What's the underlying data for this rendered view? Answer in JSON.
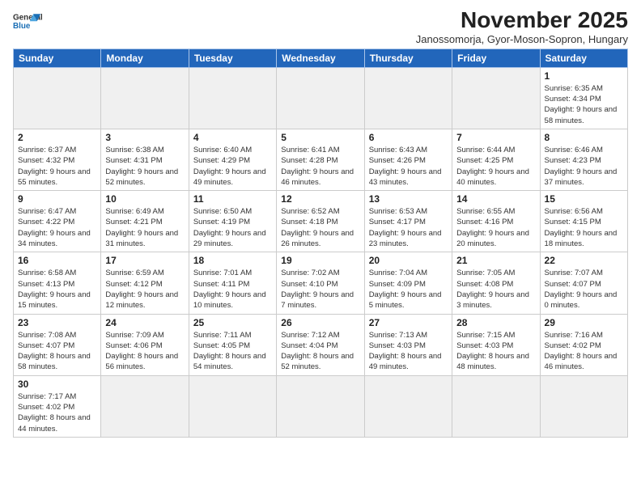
{
  "header": {
    "logo_general": "General",
    "logo_blue": "Blue",
    "month_title": "November 2025",
    "location": "Janossomorja, Gyor-Moson-Sopron, Hungary"
  },
  "days_of_week": [
    "Sunday",
    "Monday",
    "Tuesday",
    "Wednesday",
    "Thursday",
    "Friday",
    "Saturday"
  ],
  "weeks": [
    [
      {
        "day": "",
        "empty": true
      },
      {
        "day": "",
        "empty": true
      },
      {
        "day": "",
        "empty": true
      },
      {
        "day": "",
        "empty": true
      },
      {
        "day": "",
        "empty": true
      },
      {
        "day": "",
        "empty": true
      },
      {
        "day": "1",
        "sunrise": "Sunrise: 6:35 AM",
        "sunset": "Sunset: 4:34 PM",
        "daylight": "Daylight: 9 hours and 58 minutes."
      }
    ],
    [
      {
        "day": "2",
        "sunrise": "Sunrise: 6:37 AM",
        "sunset": "Sunset: 4:32 PM",
        "daylight": "Daylight: 9 hours and 55 minutes."
      },
      {
        "day": "3",
        "sunrise": "Sunrise: 6:38 AM",
        "sunset": "Sunset: 4:31 PM",
        "daylight": "Daylight: 9 hours and 52 minutes."
      },
      {
        "day": "4",
        "sunrise": "Sunrise: 6:40 AM",
        "sunset": "Sunset: 4:29 PM",
        "daylight": "Daylight: 9 hours and 49 minutes."
      },
      {
        "day": "5",
        "sunrise": "Sunrise: 6:41 AM",
        "sunset": "Sunset: 4:28 PM",
        "daylight": "Daylight: 9 hours and 46 minutes."
      },
      {
        "day": "6",
        "sunrise": "Sunrise: 6:43 AM",
        "sunset": "Sunset: 4:26 PM",
        "daylight": "Daylight: 9 hours and 43 minutes."
      },
      {
        "day": "7",
        "sunrise": "Sunrise: 6:44 AM",
        "sunset": "Sunset: 4:25 PM",
        "daylight": "Daylight: 9 hours and 40 minutes."
      },
      {
        "day": "8",
        "sunrise": "Sunrise: 6:46 AM",
        "sunset": "Sunset: 4:23 PM",
        "daylight": "Daylight: 9 hours and 37 minutes."
      }
    ],
    [
      {
        "day": "9",
        "sunrise": "Sunrise: 6:47 AM",
        "sunset": "Sunset: 4:22 PM",
        "daylight": "Daylight: 9 hours and 34 minutes."
      },
      {
        "day": "10",
        "sunrise": "Sunrise: 6:49 AM",
        "sunset": "Sunset: 4:21 PM",
        "daylight": "Daylight: 9 hours and 31 minutes."
      },
      {
        "day": "11",
        "sunrise": "Sunrise: 6:50 AM",
        "sunset": "Sunset: 4:19 PM",
        "daylight": "Daylight: 9 hours and 29 minutes."
      },
      {
        "day": "12",
        "sunrise": "Sunrise: 6:52 AM",
        "sunset": "Sunset: 4:18 PM",
        "daylight": "Daylight: 9 hours and 26 minutes."
      },
      {
        "day": "13",
        "sunrise": "Sunrise: 6:53 AM",
        "sunset": "Sunset: 4:17 PM",
        "daylight": "Daylight: 9 hours and 23 minutes."
      },
      {
        "day": "14",
        "sunrise": "Sunrise: 6:55 AM",
        "sunset": "Sunset: 4:16 PM",
        "daylight": "Daylight: 9 hours and 20 minutes."
      },
      {
        "day": "15",
        "sunrise": "Sunrise: 6:56 AM",
        "sunset": "Sunset: 4:15 PM",
        "daylight": "Daylight: 9 hours and 18 minutes."
      }
    ],
    [
      {
        "day": "16",
        "sunrise": "Sunrise: 6:58 AM",
        "sunset": "Sunset: 4:13 PM",
        "daylight": "Daylight: 9 hours and 15 minutes."
      },
      {
        "day": "17",
        "sunrise": "Sunrise: 6:59 AM",
        "sunset": "Sunset: 4:12 PM",
        "daylight": "Daylight: 9 hours and 12 minutes."
      },
      {
        "day": "18",
        "sunrise": "Sunrise: 7:01 AM",
        "sunset": "Sunset: 4:11 PM",
        "daylight": "Daylight: 9 hours and 10 minutes."
      },
      {
        "day": "19",
        "sunrise": "Sunrise: 7:02 AM",
        "sunset": "Sunset: 4:10 PM",
        "daylight": "Daylight: 9 hours and 7 minutes."
      },
      {
        "day": "20",
        "sunrise": "Sunrise: 7:04 AM",
        "sunset": "Sunset: 4:09 PM",
        "daylight": "Daylight: 9 hours and 5 minutes."
      },
      {
        "day": "21",
        "sunrise": "Sunrise: 7:05 AM",
        "sunset": "Sunset: 4:08 PM",
        "daylight": "Daylight: 9 hours and 3 minutes."
      },
      {
        "day": "22",
        "sunrise": "Sunrise: 7:07 AM",
        "sunset": "Sunset: 4:07 PM",
        "daylight": "Daylight: 9 hours and 0 minutes."
      }
    ],
    [
      {
        "day": "23",
        "sunrise": "Sunrise: 7:08 AM",
        "sunset": "Sunset: 4:07 PM",
        "daylight": "Daylight: 8 hours and 58 minutes."
      },
      {
        "day": "24",
        "sunrise": "Sunrise: 7:09 AM",
        "sunset": "Sunset: 4:06 PM",
        "daylight": "Daylight: 8 hours and 56 minutes."
      },
      {
        "day": "25",
        "sunrise": "Sunrise: 7:11 AM",
        "sunset": "Sunset: 4:05 PM",
        "daylight": "Daylight: 8 hours and 54 minutes."
      },
      {
        "day": "26",
        "sunrise": "Sunrise: 7:12 AM",
        "sunset": "Sunset: 4:04 PM",
        "daylight": "Daylight: 8 hours and 52 minutes."
      },
      {
        "day": "27",
        "sunrise": "Sunrise: 7:13 AM",
        "sunset": "Sunset: 4:03 PM",
        "daylight": "Daylight: 8 hours and 49 minutes."
      },
      {
        "day": "28",
        "sunrise": "Sunrise: 7:15 AM",
        "sunset": "Sunset: 4:03 PM",
        "daylight": "Daylight: 8 hours and 48 minutes."
      },
      {
        "day": "29",
        "sunrise": "Sunrise: 7:16 AM",
        "sunset": "Sunset: 4:02 PM",
        "daylight": "Daylight: 8 hours and 46 minutes."
      }
    ],
    [
      {
        "day": "30",
        "sunrise": "Sunrise: 7:17 AM",
        "sunset": "Sunset: 4:02 PM",
        "daylight": "Daylight: 8 hours and 44 minutes."
      },
      {
        "day": "",
        "empty": true
      },
      {
        "day": "",
        "empty": true
      },
      {
        "day": "",
        "empty": true
      },
      {
        "day": "",
        "empty": true
      },
      {
        "day": "",
        "empty": true
      },
      {
        "day": "",
        "empty": true
      }
    ]
  ]
}
